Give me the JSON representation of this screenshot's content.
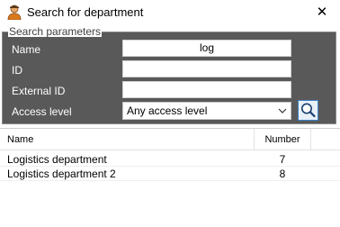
{
  "window": {
    "title": "Search for department",
    "close_glyph": "✕",
    "icon": "user-icon"
  },
  "search_parameters": {
    "legend": "Search parameters",
    "fields": [
      {
        "label": "Name",
        "value": "log"
      },
      {
        "label": "ID",
        "value": ""
      },
      {
        "label": "External ID",
        "value": ""
      }
    ],
    "access_level": {
      "label": "Access level",
      "selected": "Any access level"
    },
    "search_button_icon": "magnifier-icon"
  },
  "results": {
    "columns": [
      "Name",
      "Number"
    ],
    "rows": [
      {
        "name": "Logistics department",
        "number": "7"
      },
      {
        "name": "Logistics department 2",
        "number": "8"
      }
    ]
  },
  "colors": {
    "panel": "#595959",
    "accent": "#3c7fc7"
  }
}
